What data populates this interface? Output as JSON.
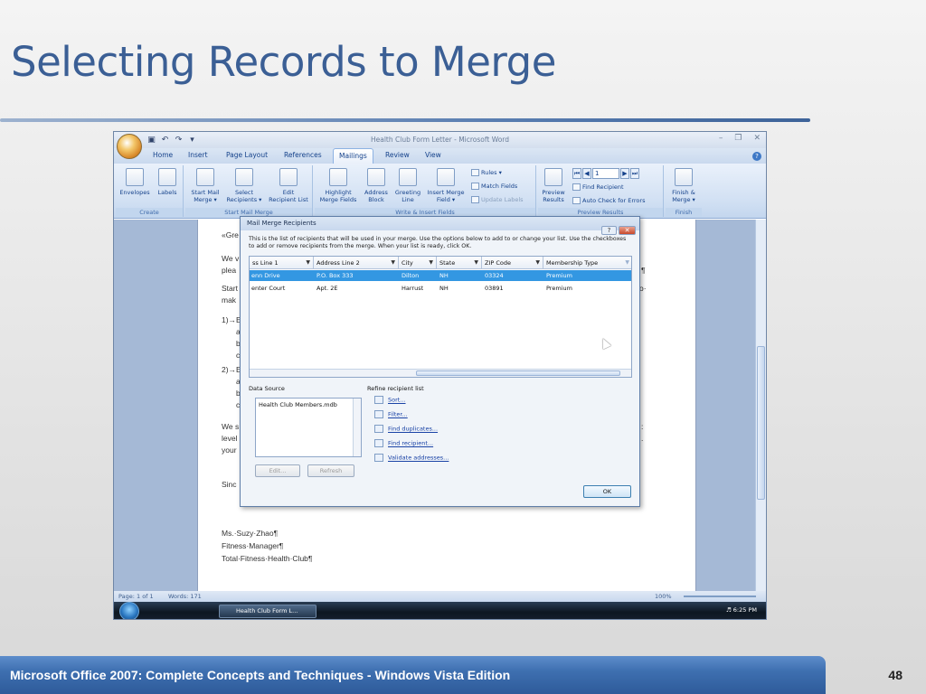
{
  "slide": {
    "title": "Selecting Records to Merge",
    "footer": "Microsoft Office 2007: Complete Concepts and Techniques - Windows Vista Edition",
    "page_number": "48"
  },
  "window": {
    "title": "Health Club Form Letter - Microsoft Word",
    "tabs": [
      "Home",
      "Insert",
      "Page Layout",
      "References",
      "Mailings",
      "Review",
      "View"
    ],
    "active_tab": "Mailings"
  },
  "ribbon": {
    "create": {
      "label": "Create",
      "envelopes": "Envelopes",
      "labels": "Labels"
    },
    "start": {
      "label": "Start Mail Merge",
      "start_mail_merge": [
        "Start Mail",
        "Merge ▾"
      ],
      "select_recipients": [
        "Select",
        "Recipients ▾"
      ],
      "edit_recipient_list": [
        "Edit",
        "Recipient List"
      ]
    },
    "write": {
      "label": "Write & Insert Fields",
      "highlight": [
        "Highlight",
        "Merge Fields"
      ],
      "address_block": [
        "Address",
        "Block"
      ],
      "greeting_line": [
        "Greeting",
        "Line"
      ],
      "insert_merge_field": [
        "Insert Merge",
        "Field ▾"
      ],
      "rules": "Rules ▾",
      "match_fields": "Match Fields",
      "update_labels": "Update Labels"
    },
    "preview": {
      "label": "Preview Results",
      "preview_results": [
        "Preview",
        "Results"
      ],
      "record_number": "1",
      "find_recipient": "Find Recipient",
      "auto_check": "Auto Check for Errors"
    },
    "finish": {
      "label": "Finish",
      "finish_merge": [
        "Finish &",
        "Merge ▾"
      ]
    }
  },
  "document": {
    "lines": [
      "«Gre",
      "We v",
      "plea",
      "Start",
      "mak",
      "1)→E",
      "a",
      "b",
      "c",
      "2)→E",
      "a",
      "b",
      "c",
      "We s",
      "level",
      "your",
      "Sinc",
      "Ms.·Suzy·Zhao¶",
      "Fitness·Manager¶",
      "Total·Fitness·Health·Club¶"
    ],
    "right_fragments": [
      "¶",
      "o·",
      ":",
      "."
    ]
  },
  "dialog": {
    "title": "Mail Merge Recipients",
    "instructions": "This is the list of recipients that will be used in your merge.  Use the options below to add to or change your list.  Use the checkboxes to add or remove recipients from the merge.  When your list is ready, click OK.",
    "columns": [
      "ss Line 1",
      "Address Line 2",
      "City",
      "State",
      "ZIP Code",
      "Membership Type"
    ],
    "rows": [
      [
        "enn Drive",
        "P.O. Box 333",
        "Dilton",
        "NH",
        "03324",
        "Premium"
      ],
      [
        "enter Court",
        "Apt. 2E",
        "Harrust",
        "NH",
        "03891",
        "Premium"
      ]
    ],
    "data_source_label": "Data Source",
    "data_source_item": "Health Club Members.mdb",
    "edit_button": "Edit...",
    "refresh_button": "Refresh",
    "refine_label": "Refine recipient list",
    "refine_links": [
      "Sort...",
      "Filter...",
      "Find duplicates...",
      "Find recipient...",
      "Validate addresses..."
    ],
    "ok_button": "OK"
  },
  "statusbar": {
    "page": "Page: 1 of 1",
    "words": "Words: 171",
    "zoom": "100%"
  },
  "taskbar": {
    "task": "Health Club Form L...",
    "time": "6:25 PM"
  }
}
